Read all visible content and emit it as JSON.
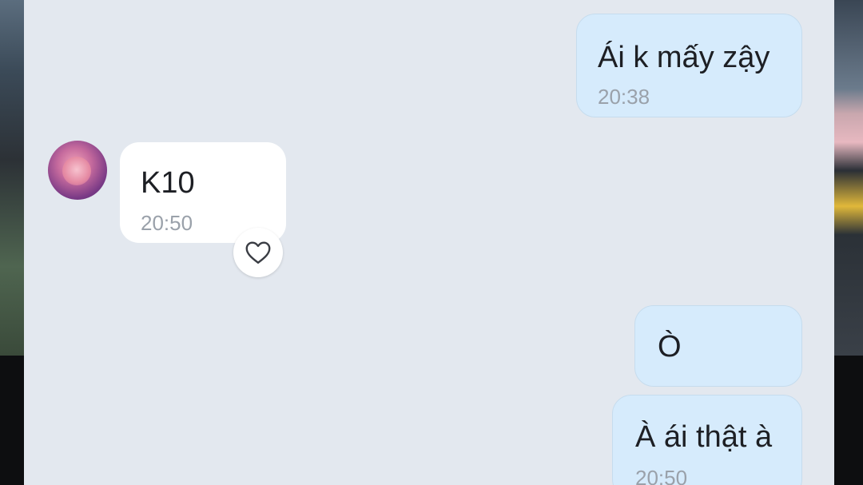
{
  "messages": [
    {
      "direction": "outgoing",
      "text": "Ái k mấy zậy",
      "time": "20:38"
    },
    {
      "direction": "incoming",
      "text": "K10",
      "time": "20:50"
    },
    {
      "direction": "outgoing",
      "text": "Ò",
      "time": ""
    },
    {
      "direction": "outgoing",
      "text": "À ái thật à",
      "time": "20:50"
    }
  ],
  "reaction_icon": "heart-outline-icon",
  "colors": {
    "chat_background": "#e3e8ef",
    "outgoing_bubble": "#d6ebfc",
    "incoming_bubble": "#ffffff",
    "timestamp": "#9aa1aa"
  }
}
